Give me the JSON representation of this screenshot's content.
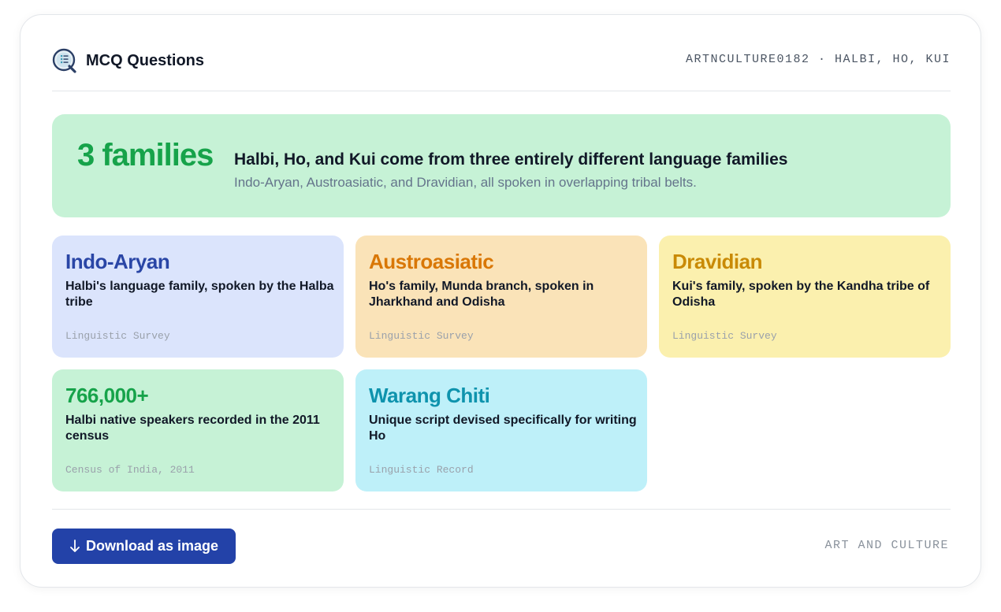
{
  "header": {
    "title": "MCQ Questions",
    "meta": "ARTNCULTURE0182 · HALBI, HO, KUI",
    "logo_icon": "quiz-logo-icon"
  },
  "hero": {
    "stat": "3 families",
    "title": "Halbi, Ho, and Kui come from three entirely different language families",
    "subtitle": "Indo-Aryan, Austroasiatic, and Dravidian, all spoken in overlapping tribal belts.",
    "stat_color": "#16a34a",
    "background": "#c6f2d6"
  },
  "tiles": [
    {
      "title": "Indo-Aryan",
      "description": "Halbi's language family, spoken by the Halba tribe",
      "source": "Linguistic Survey",
      "title_color": "#2a46a6",
      "background": "#dbe4fc"
    },
    {
      "title": "Austroasiatic",
      "description": "Ho's family, Munda branch, spoken in Jharkhand and Odisha",
      "source": "Linguistic Survey",
      "title_color": "#d97706",
      "background": "#fae3b8"
    },
    {
      "title": "Dravidian",
      "description": "Kui's family, spoken by the Kandha tribe of Odisha",
      "source": "Linguistic Survey",
      "title_color": "#c98a06",
      "background": "#fbf0ae"
    },
    {
      "title": "766,000+",
      "description": "Halbi native speakers recorded in the 2011 census",
      "source": "Census of India, 2011",
      "title_color": "#16a34a",
      "background": "#c6f2d6"
    },
    {
      "title": "Warang Chiti",
      "description": "Unique script devised specifically for writing Ho",
      "source": "Linguistic Record",
      "title_color": "#0e93ad",
      "background": "#bef0f9"
    }
  ],
  "footer": {
    "download_label": "Download as image",
    "download_icon": "download-arrow-icon",
    "button_color": "#2342a8",
    "category": "ART AND CULTURE"
  }
}
